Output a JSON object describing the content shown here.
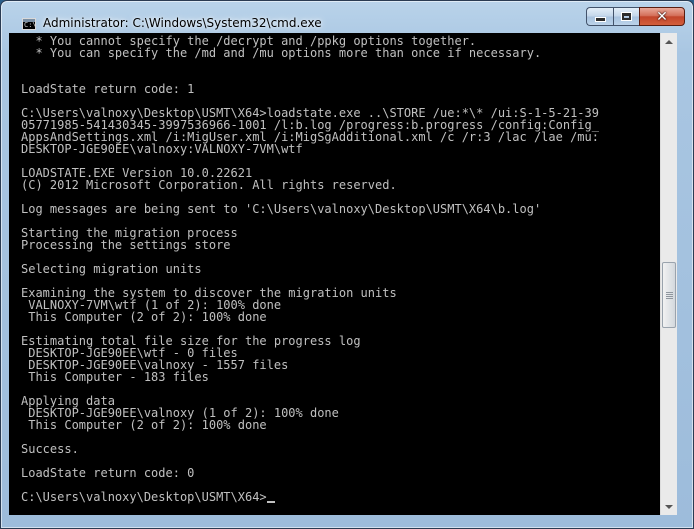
{
  "window": {
    "title": "Administrator: C:\\Windows\\System32\\cmd.exe",
    "icon_text": "C:\\",
    "close_glyph": "✕"
  },
  "console": {
    "lines": [
      "  * You cannot specify the /decrypt and /ppkg options together.",
      "  * You can specify the /md and /mu options more than once if necessary.",
      "",
      "",
      "LoadState return code: 1",
      "",
      "C:\\Users\\valnoxy\\Desktop\\USMT\\X64>loadstate.exe ..\\STORE /ue:*\\* /ui:S-1-5-21-39",
      "05771985-541430345-3997536966-1001 /l:b.log /progress:b.progress /config:Config_",
      "AppsAndSettings.xml /i:MigUser.xml /i:MigSgAdditional.xml /c /r:3 /lac /lae /mu:",
      "DESKTOP-JGE90EE\\valnoxy:VALNOXY-7VM\\wtf",
      "",
      "LOADSTATE.EXE Version 10.0.22621",
      "(C) 2012 Microsoft Corporation. All rights reserved.",
      "",
      "Log messages are being sent to 'C:\\Users\\valnoxy\\Desktop\\USMT\\X64\\b.log'",
      "",
      "Starting the migration process",
      "Processing the settings store",
      "",
      "Selecting migration units",
      "",
      "Examining the system to discover the migration units",
      " VALNOXY-7VM\\wtf (1 of 2): 100% done",
      " This Computer (2 of 2): 100% done",
      "",
      "Estimating total file size for the progress log",
      " DESKTOP-JGE90EE\\wtf - 0 files",
      " DESKTOP-JGE90EE\\valnoxy - 1557 files",
      " This Computer - 183 files",
      "",
      "Applying data",
      " DESKTOP-JGE90EE\\valnoxy (1 of 2): 100% done",
      " This Computer (2 of 2): 100% done",
      "",
      "Success.",
      "",
      "LoadState return code: 0",
      "",
      "C:\\Users\\valnoxy\\Desktop\\USMT\\X64>"
    ]
  },
  "scrollbar": {
    "position_fraction": 0.5
  },
  "colors": {
    "console_bg": "#000000",
    "console_fg": "#c0c0c0",
    "close_button": "#c2452b"
  }
}
